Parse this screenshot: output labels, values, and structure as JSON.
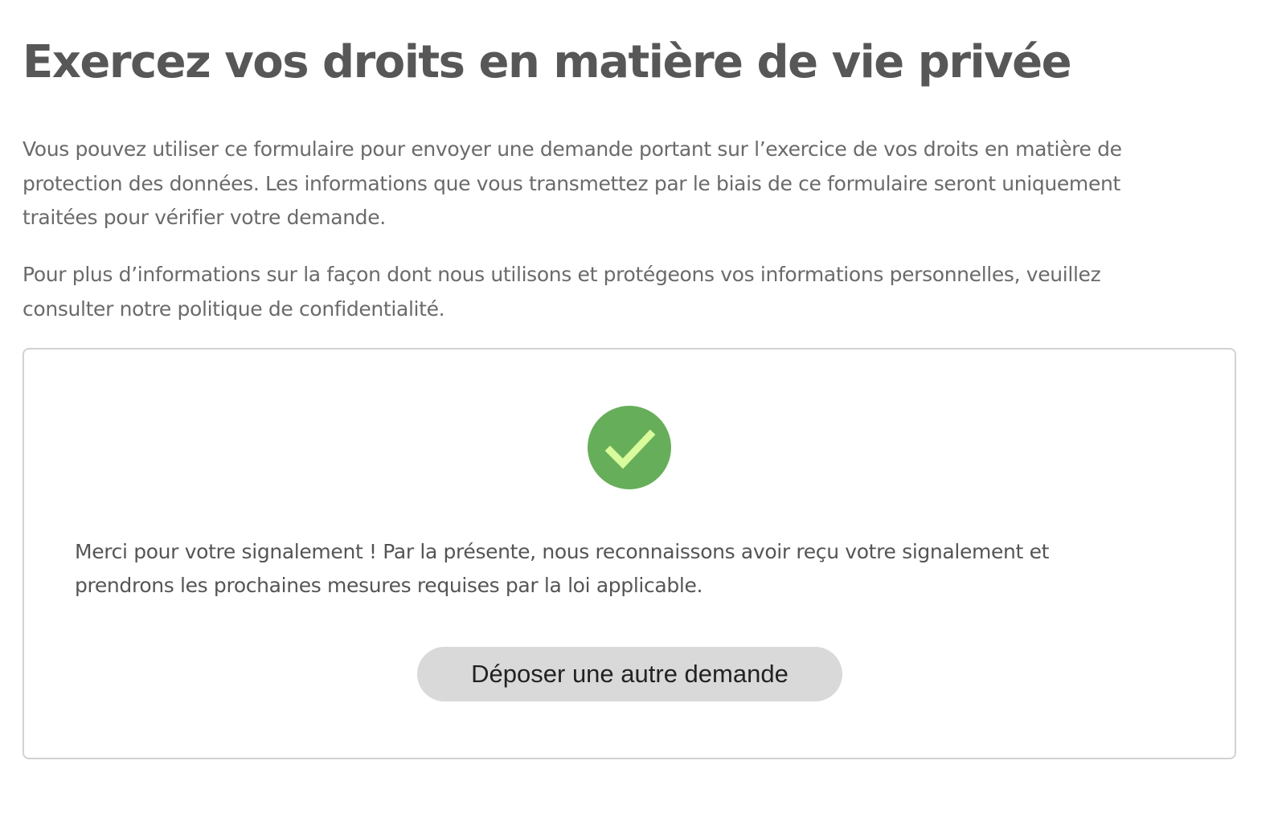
{
  "page": {
    "title": "Exercez vos droits en matière de vie privée",
    "intro_paragraph_1": "Vous pouvez utiliser ce formulaire pour envoyer une demande portant sur l’exercice de vos droits en matière de protection des données. Les informations que vous transmettez par le biais de ce formulaire seront uniquement traitées pour vérifier votre demande.",
    "intro_paragraph_2": "Pour plus d’informations sur la façon dont nous utilisons et protégeons vos informations personnelles, veuillez consulter notre politique de confidentialité."
  },
  "confirmation": {
    "icon": "checkmark-circle-icon",
    "icon_colors": {
      "circle": "#67ae5a",
      "check": "#d9fb9c"
    },
    "message": "Merci pour votre signalement ! Par la présente, nous reconnaissons avoir reçu votre signalement et prendrons les prochaines mesures requises par la loi applicable.",
    "button_label": "Déposer une autre demande"
  }
}
